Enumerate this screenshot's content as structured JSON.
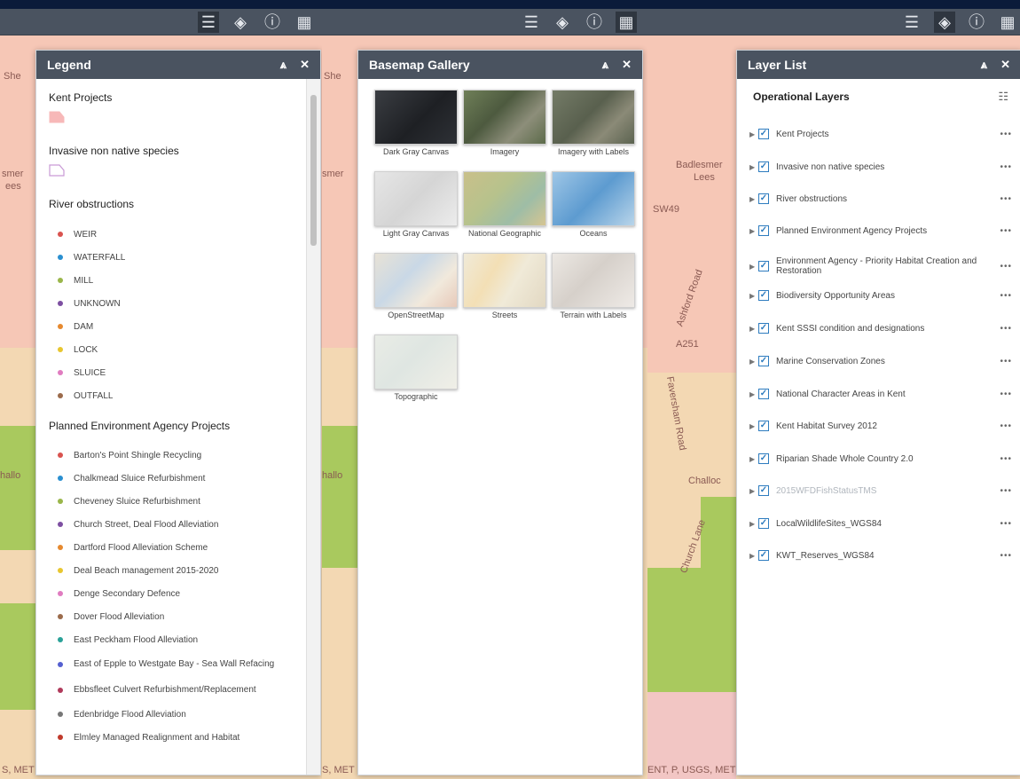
{
  "toolbar": {
    "icons": [
      "legend-icon",
      "layers-icon",
      "info-icon",
      "grid-icon"
    ]
  },
  "legend": {
    "title": "Legend",
    "collapse": "⩓",
    "close": "✕",
    "kent_projects": "Kent Projects",
    "invasive": "Invasive non native species",
    "river_obstructions": "River obstructions",
    "river_items": [
      {
        "label": "WEIR",
        "color": "#d9534f"
      },
      {
        "label": "WATERFALL",
        "color": "#2a8fd0"
      },
      {
        "label": "MILL",
        "color": "#9ab64a"
      },
      {
        "label": "UNKNOWN",
        "color": "#7d4fa1"
      },
      {
        "label": "DAM",
        "color": "#e6892f"
      },
      {
        "label": "LOCK",
        "color": "#e8c62f"
      },
      {
        "label": "SLUICE",
        "color": "#e07cc0"
      },
      {
        "label": "OUTFALL",
        "color": "#9b6b4b"
      }
    ],
    "planned": "Planned Environment Agency Projects",
    "planned_items": [
      {
        "label": "Barton's Point Shingle Recycling",
        "color": "#d9534f"
      },
      {
        "label": "Chalkmead Sluice Refurbishment",
        "color": "#2a8fd0"
      },
      {
        "label": "Cheveney Sluice Refurbishment",
        "color": "#9ab64a"
      },
      {
        "label": "Church Street, Deal Flood Alleviation",
        "color": "#7d4fa1"
      },
      {
        "label": "Dartford Flood Alleviation Scheme",
        "color": "#e6892f"
      },
      {
        "label": "Deal Beach management 2015-2020",
        "color": "#e8c62f"
      },
      {
        "label": "Denge Secondary Defence",
        "color": "#e07cc0"
      },
      {
        "label": "Dover Flood Alleviation",
        "color": "#9b6b4b"
      },
      {
        "label": "East Peckham Flood Alleviation",
        "color": "#2aa198"
      },
      {
        "label": "East of Epple to Westgate Bay - Sea Wall Refacing",
        "color": "#5560d0"
      },
      {
        "label": "Ebbsfleet Culvert Refurbishment/Replacement",
        "color": "#b03a5b"
      },
      {
        "label": "Edenbridge Flood Alleviation",
        "color": "#777777"
      },
      {
        "label": "Elmley Managed Realignment and Habitat",
        "color": "#c0392b"
      }
    ]
  },
  "basemap": {
    "title": "Basemap Gallery",
    "collapse": "⩓",
    "close": "✕",
    "tiles": [
      {
        "label": "Dark Gray Canvas"
      },
      {
        "label": "Imagery"
      },
      {
        "label": "Imagery with Labels"
      },
      {
        "label": "Light Gray Canvas"
      },
      {
        "label": "National Geographic"
      },
      {
        "label": "Oceans"
      },
      {
        "label": "OpenStreetMap"
      },
      {
        "label": "Streets"
      },
      {
        "label": "Terrain with Labels"
      },
      {
        "label": "Topographic"
      }
    ]
  },
  "layerlist": {
    "title": "Layer List",
    "collapse": "⩓",
    "close": "✕",
    "ops": "Operational Layers",
    "more": "•••",
    "layers": [
      "Kent Projects",
      "Invasive non native species",
      "River obstructions",
      "Planned Environment Agency Projects",
      "Environment Agency - Priority Habitat Creation and Restoration",
      "Biodiversity Opportunity Areas",
      "Kent SSSI condition and designations",
      "Marine Conservation Zones",
      "National Character Areas in Kent",
      "Kent Habitat Survey 2012",
      "Riparian Shade Whole Country 2.0",
      "2015WFDFishStatusTMS",
      "LocalWildlifeSites_WGS84",
      "KWT_Reserves_WGS84"
    ]
  },
  "map_labels": {
    "she": "She",
    "smer": "smer",
    "ees": "ees",
    "hallo": "hallo",
    "met": "S, MET",
    "badlesmere": "Badlesmer",
    "lees": "Lees",
    "sw49": "SW49",
    "ashford_road": "Ashford Road",
    "a251": "A251",
    "faversham_road": "Faversham Road",
    "challock": "Challoc",
    "church_lane": "Church Lane",
    "footer": "ENT, P, USGS, MET"
  }
}
